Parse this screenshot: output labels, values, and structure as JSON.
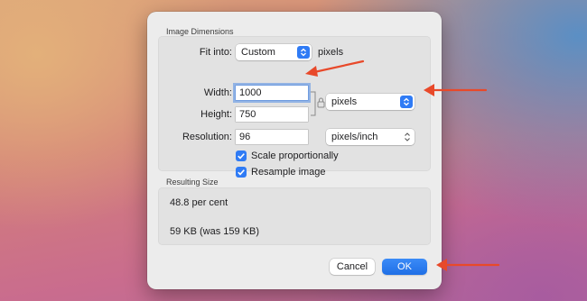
{
  "dimensions": {
    "section_title": "Image Dimensions",
    "fit_into": {
      "label": "Fit into:",
      "value": "Custom",
      "unit": "pixels"
    },
    "width": {
      "label": "Width:",
      "value": "1000"
    },
    "height": {
      "label": "Height:",
      "value": "750"
    },
    "size_unit": {
      "value": "pixels"
    },
    "resolution": {
      "label": "Resolution:",
      "value": "96",
      "unit": "pixels/inch"
    },
    "scale_proportionally": {
      "label": "Scale proportionally",
      "checked": true
    },
    "resample_image": {
      "label": "Resample image",
      "checked": true
    }
  },
  "result": {
    "section_title": "Resulting Size",
    "percent": "48.8 per cent",
    "file_size": "59 KB (was 159 KB)"
  },
  "buttons": {
    "cancel": "Cancel",
    "ok": "OK"
  },
  "colors": {
    "accent": "#2f7bf5",
    "annotation_arrow": "#e8492a"
  }
}
